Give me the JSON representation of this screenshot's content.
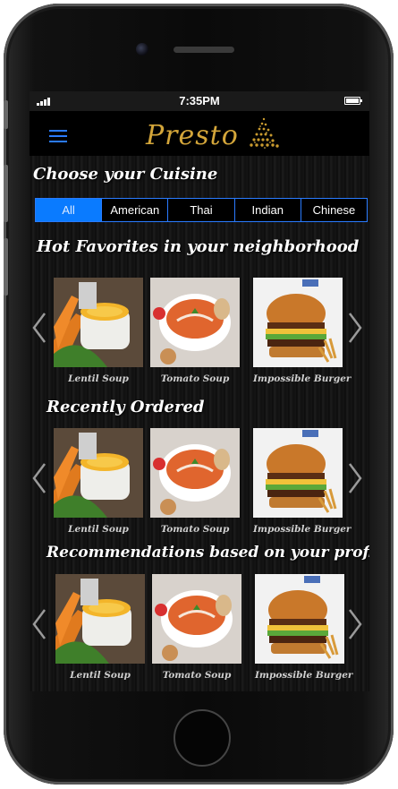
{
  "status": {
    "time": "7:35PM"
  },
  "header": {
    "brand": "Presto",
    "menu_icon": "hamburger-menu-icon",
    "logo_icon": "golden-tree-icon"
  },
  "cuisine": {
    "title": "Choose your Cuisine",
    "tabs": [
      "All",
      "American",
      "Thai",
      "Indian",
      "Chinese"
    ],
    "selected": "All"
  },
  "sections": [
    {
      "title": "Hot Favorites in your neighborhood",
      "items": [
        {
          "name": "Lentil  Soup"
        },
        {
          "name": "Tomato Soup"
        },
        {
          "name": "Impossible Burger"
        }
      ]
    },
    {
      "title": "Recently Ordered",
      "items": [
        {
          "name": "Lentil  Soup"
        },
        {
          "name": "Tomato Soup"
        },
        {
          "name": "Impossible Burger"
        }
      ]
    },
    {
      "title": "Recommendations based on your profile",
      "items": [
        {
          "name": "Lentil  Soup"
        },
        {
          "name": "Tomato Soup"
        },
        {
          "name": "Impossible Burger"
        }
      ]
    }
  ],
  "colors": {
    "accent": "#0a7bff",
    "brand": "#d4a63a",
    "background": "#121212"
  }
}
